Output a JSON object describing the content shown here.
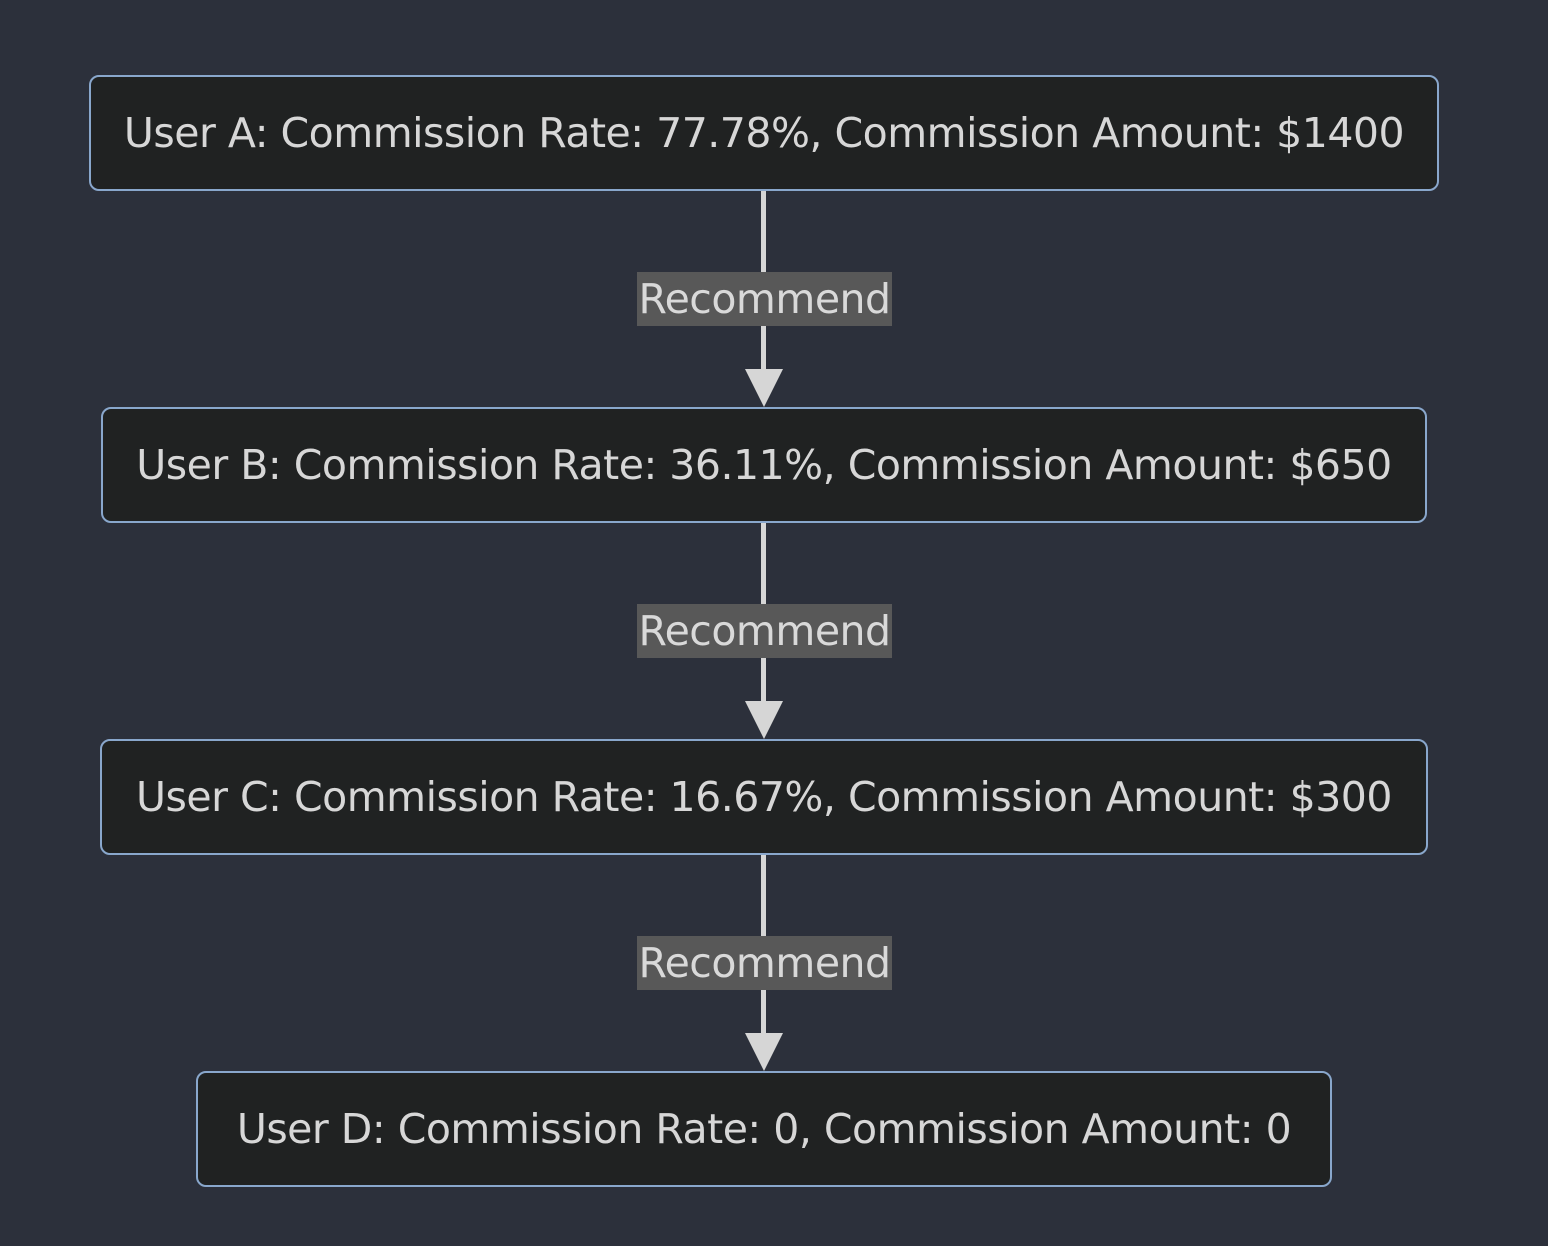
{
  "nodes": {
    "a": "User A: Commission Rate: 77.78%, Commission Amount: $1400",
    "b": "User B: Commission Rate: 36.11%, Commission Amount: $650",
    "c": "User C: Commission Rate: 16.67%, Commission Amount: $300",
    "d": "User D: Commission Rate: 0, Commission Amount: 0"
  },
  "edges": [
    {
      "from": "a",
      "to": "b",
      "label": "Recommend"
    },
    {
      "from": "b",
      "to": "c",
      "label": "Recommend"
    },
    {
      "from": "c",
      "to": "d",
      "label": "Recommend"
    }
  ],
  "colors": {
    "background": "#2c303b",
    "node_fill": "#202222",
    "node_border": "#89a7cc",
    "edge": "#d6d6d6",
    "label_fill": "#585858",
    "text": "#d7d7d7"
  }
}
